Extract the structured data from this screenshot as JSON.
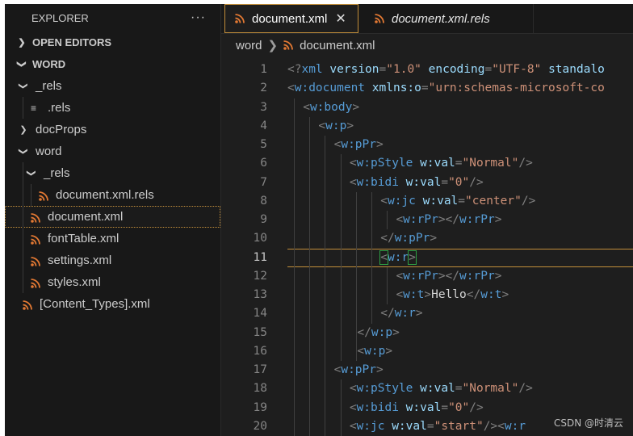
{
  "sidebar": {
    "title": "EXPLORER",
    "more": "···",
    "sections": {
      "open_editors": "OPEN EDITORS",
      "word_root": "WORD"
    },
    "tree": [
      {
        "label": "_rels",
        "kind": "folder-open",
        "depth": 1
      },
      {
        "label": ".rels",
        "kind": "file-lines",
        "depth": 2
      },
      {
        "label": "docProps",
        "kind": "folder-closed",
        "depth": 1
      },
      {
        "label": "word",
        "kind": "folder-open",
        "depth": 1
      },
      {
        "label": "_rels",
        "kind": "folder-open",
        "depth": 2
      },
      {
        "label": "document.xml.rels",
        "kind": "file-rss",
        "depth": 3
      },
      {
        "label": "document.xml",
        "kind": "file-rss",
        "depth": 2,
        "selected": true
      },
      {
        "label": "fontTable.xml",
        "kind": "file-rss",
        "depth": 2
      },
      {
        "label": "settings.xml",
        "kind": "file-rss",
        "depth": 2
      },
      {
        "label": "styles.xml",
        "kind": "file-rss",
        "depth": 2
      },
      {
        "label": "[Content_Types].xml",
        "kind": "file-rss",
        "depth": 1
      }
    ]
  },
  "tabs": {
    "active": "document.xml",
    "inactive": "document.xml.rels",
    "close": "✕"
  },
  "breadcrumb": {
    "folder": "word",
    "file": "document.xml"
  },
  "editor": {
    "current_line": 11,
    "lines": [
      {
        "n": "1",
        "indent": 0,
        "t": [
          [
            "p",
            "<?"
          ],
          [
            "tag",
            "xml"
          ],
          [
            "txt",
            " "
          ],
          [
            "attr",
            "version"
          ],
          [
            "p",
            "="
          ],
          [
            "str",
            "\"1.0\""
          ],
          [
            "txt",
            " "
          ],
          [
            "attr",
            "encoding"
          ],
          [
            "p",
            "="
          ],
          [
            "str",
            "\"UTF-8\""
          ],
          [
            "txt",
            " "
          ],
          [
            "attr",
            "standalo"
          ]
        ]
      },
      {
        "n": "2",
        "indent": 0,
        "t": [
          [
            "p",
            "<"
          ],
          [
            "tag",
            "w:document"
          ],
          [
            "txt",
            " "
          ],
          [
            "attr",
            "xmlns:o"
          ],
          [
            "p",
            "="
          ],
          [
            "str",
            "\"urn:schemas-microsoft-co"
          ]
        ]
      },
      {
        "n": "3",
        "indent": 1,
        "t": [
          [
            "p",
            "<"
          ],
          [
            "tag",
            "w:body"
          ],
          [
            "p",
            ">"
          ]
        ]
      },
      {
        "n": "4",
        "indent": 2,
        "t": [
          [
            "p",
            "<"
          ],
          [
            "tag",
            "w:p"
          ],
          [
            "p",
            ">"
          ]
        ]
      },
      {
        "n": "5",
        "indent": 3,
        "t": [
          [
            "p",
            "<"
          ],
          [
            "tag",
            "w:pPr"
          ],
          [
            "p",
            ">"
          ]
        ]
      },
      {
        "n": "6",
        "indent": 4,
        "t": [
          [
            "p",
            "<"
          ],
          [
            "tag",
            "w:pStyle"
          ],
          [
            "txt",
            " "
          ],
          [
            "attr",
            "w:val"
          ],
          [
            "p",
            "="
          ],
          [
            "str",
            "\"Normal\""
          ],
          [
            "p",
            "/>"
          ]
        ]
      },
      {
        "n": "7",
        "indent": 4,
        "t": [
          [
            "p",
            "<"
          ],
          [
            "tag",
            "w:bidi"
          ],
          [
            "txt",
            " "
          ],
          [
            "attr",
            "w:val"
          ],
          [
            "p",
            "="
          ],
          [
            "str",
            "\"0\""
          ],
          [
            "p",
            "/>"
          ]
        ]
      },
      {
        "n": "8",
        "indent": 6,
        "t": [
          [
            "p",
            "<"
          ],
          [
            "tag",
            "w:jc"
          ],
          [
            "txt",
            " "
          ],
          [
            "attr",
            "w:val"
          ],
          [
            "p",
            "="
          ],
          [
            "str",
            "\"center\""
          ],
          [
            "p",
            "/>"
          ]
        ]
      },
      {
        "n": "9",
        "indent": 7,
        "t": [
          [
            "p",
            "<"
          ],
          [
            "tag",
            "w:rPr"
          ],
          [
            "p",
            "></"
          ],
          [
            "tag",
            "w:rPr"
          ],
          [
            "p",
            ">"
          ]
        ]
      },
      {
        "n": "10",
        "indent": 6,
        "t": [
          [
            "p",
            "</"
          ],
          [
            "tag",
            "w:pPr"
          ],
          [
            "p",
            ">"
          ]
        ]
      },
      {
        "n": "11",
        "indent": 6,
        "t": [
          [
            "pb",
            "<"
          ],
          [
            "tag",
            "w:r"
          ],
          [
            "pb",
            ">"
          ]
        ]
      },
      {
        "n": "12",
        "indent": 7,
        "t": [
          [
            "p",
            "<"
          ],
          [
            "tag",
            "w:rPr"
          ],
          [
            "p",
            "></"
          ],
          [
            "tag",
            "w:rPr"
          ],
          [
            "p",
            ">"
          ]
        ]
      },
      {
        "n": "13",
        "indent": 7,
        "t": [
          [
            "p",
            "<"
          ],
          [
            "tag",
            "w:t"
          ],
          [
            "p",
            ">"
          ],
          [
            "txt",
            "Hello"
          ],
          [
            "p",
            "</"
          ],
          [
            "tag",
            "w:t"
          ],
          [
            "p",
            ">"
          ]
        ]
      },
      {
        "n": "14",
        "indent": 6,
        "t": [
          [
            "p",
            "</"
          ],
          [
            "tag",
            "w:r"
          ],
          [
            "p",
            ">"
          ]
        ]
      },
      {
        "n": "15",
        "indent": 4.5,
        "t": [
          [
            "p",
            "</"
          ],
          [
            "tag",
            "w:p"
          ],
          [
            "p",
            ">"
          ]
        ]
      },
      {
        "n": "16",
        "indent": 4.5,
        "t": [
          [
            "p",
            "<"
          ],
          [
            "tag",
            "w:p"
          ],
          [
            "p",
            ">"
          ]
        ]
      },
      {
        "n": "17",
        "indent": 3,
        "t": [
          [
            "p",
            "<"
          ],
          [
            "tag",
            "w:pPr"
          ],
          [
            "p",
            ">"
          ]
        ]
      },
      {
        "n": "18",
        "indent": 4,
        "t": [
          [
            "p",
            "<"
          ],
          [
            "tag",
            "w:pStyle"
          ],
          [
            "txt",
            " "
          ],
          [
            "attr",
            "w:val"
          ],
          [
            "p",
            "="
          ],
          [
            "str",
            "\"Normal\""
          ],
          [
            "p",
            "/>"
          ]
        ]
      },
      {
        "n": "19",
        "indent": 4,
        "t": [
          [
            "p",
            "<"
          ],
          [
            "tag",
            "w:bidi"
          ],
          [
            "txt",
            " "
          ],
          [
            "attr",
            "w:val"
          ],
          [
            "p",
            "="
          ],
          [
            "str",
            "\"0\""
          ],
          [
            "p",
            "/>"
          ]
        ]
      },
      {
        "n": "20",
        "indent": 4,
        "t": [
          [
            "p",
            "<"
          ],
          [
            "tag",
            "w:jc"
          ],
          [
            "txt",
            " "
          ],
          [
            "attr",
            "w:val"
          ],
          [
            "p",
            "="
          ],
          [
            "str",
            "\"start\""
          ],
          [
            "p",
            "/><"
          ],
          [
            "tag",
            "w:r"
          ]
        ]
      }
    ]
  },
  "watermark": "CSDN @时清云",
  "colors": {
    "accent": "#c28e3a",
    "rss_icon": "#e37933",
    "tag": "#569cd6",
    "attr": "#9cdcfe",
    "string": "#ce9178"
  }
}
